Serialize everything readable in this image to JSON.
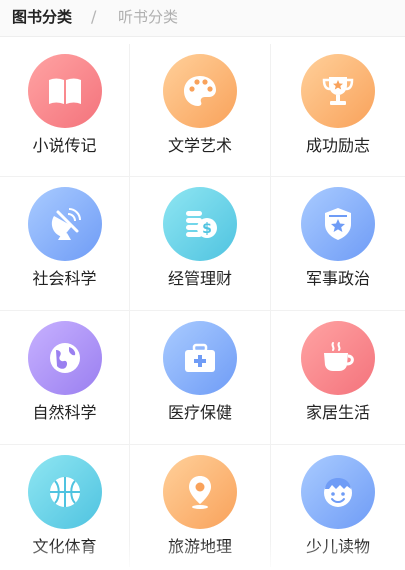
{
  "tabs": {
    "active": "图书分类",
    "separator": "/",
    "inactive": "听书分类"
  },
  "categories": [
    {
      "label": "小说传记",
      "icon": "book-icon",
      "colors": [
        "#ffa3a3",
        "#f4737c"
      ]
    },
    {
      "label": "文学艺术",
      "icon": "palette-icon",
      "colors": [
        "#ffd09a",
        "#f9a25b"
      ]
    },
    {
      "label": "成功励志",
      "icon": "trophy-icon",
      "colors": [
        "#ffd09a",
        "#f9a25b"
      ]
    },
    {
      "label": "社会科学",
      "icon": "satellite-dish-icon",
      "colors": [
        "#a9cbff",
        "#6f9cf6"
      ]
    },
    {
      "label": "经管理财",
      "icon": "coins-icon",
      "colors": [
        "#8fe6f2",
        "#4fc3e0"
      ]
    },
    {
      "label": "军事政治",
      "icon": "military-badge-icon",
      "colors": [
        "#a9cbff",
        "#6f9cf6"
      ]
    },
    {
      "label": "自然科学",
      "icon": "globe-icon",
      "colors": [
        "#c7b1ff",
        "#9a7ff0"
      ]
    },
    {
      "label": "医疗保健",
      "icon": "medical-kit-icon",
      "colors": [
        "#a9cbff",
        "#6f9cf6"
      ]
    },
    {
      "label": "家居生活",
      "icon": "coffee-cup-icon",
      "colors": [
        "#ffa3a3",
        "#f4737c"
      ]
    },
    {
      "label": "文化体育",
      "icon": "basketball-icon",
      "colors": [
        "#8fe6f2",
        "#4fc3e0"
      ]
    },
    {
      "label": "旅游地理",
      "icon": "map-pin-icon",
      "colors": [
        "#ffd09a",
        "#f9a25b"
      ]
    },
    {
      "label": "少儿读物",
      "icon": "child-face-icon",
      "colors": [
        "#a9cbff",
        "#6f9cf6"
      ]
    }
  ]
}
